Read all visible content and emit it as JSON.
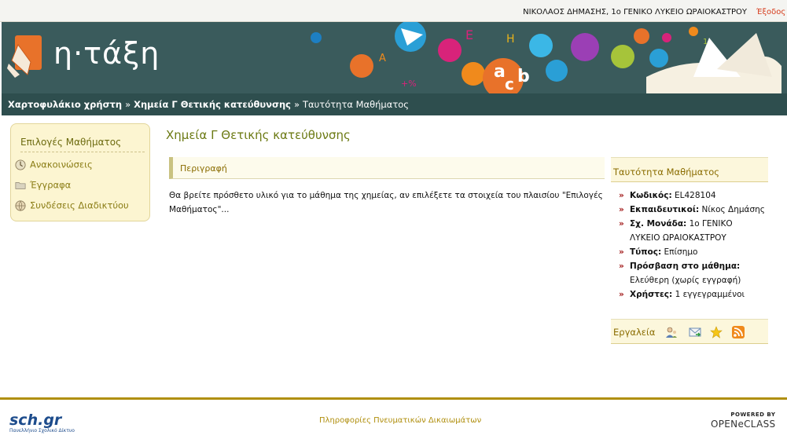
{
  "user_bar": {
    "user": "ΝΙΚΟΛΑΟΣ ΔΗΜΑΣΗΣ, 1ο ΓΕΝΙΚΟ ΛΥΚΕΙΟ ΩΡΑΙΟΚΑΣΤΡΟΥ",
    "logout": "Έξοδος"
  },
  "logo": {
    "text": "η·τάξη"
  },
  "breadcrumb": {
    "items": [
      "Χαρτοφυλάκιο χρήστη",
      "Χημεία Γ Θετικής κατεύθυνσης",
      "Ταυτότητα Μαθήματος"
    ],
    "separator": "»"
  },
  "sidebar": {
    "title": "Επιλογές Μαθήματος",
    "items": [
      {
        "label": "Ανακοινώσεις",
        "icon": "clock-icon"
      },
      {
        "label": "Έγγραφα",
        "icon": "folder-icon"
      },
      {
        "label": "Συνδέσεις Διαδικτύου",
        "icon": "globe-icon"
      }
    ]
  },
  "main": {
    "course_title": "Χημεία Γ Θετικής κατεύθυνσης",
    "section_label": "Περιγραφή",
    "description_line1": "Θα βρείτε πρόσθετο υλικό για το μάθημα της χημείας, αν επιλέξετε τα στοιχεία του πλαισίου \"Επιλογές",
    "description_line2": "Μαθήματος\"..."
  },
  "course_info": {
    "title": "Ταυτότητα Μαθήματος",
    "rows": [
      {
        "label": "Κωδικός:",
        "value": "EL428104"
      },
      {
        "label": "Εκπαιδευτικοί:",
        "value": "Νίκος Δημάσης"
      },
      {
        "label": "Σχ. Μονάδα:",
        "value": "1ο ΓΕΝΙΚΟ",
        "value2": "ΛΥΚΕΙΟ ΩΡΑΙΟΚΑΣΤΡΟΥ"
      },
      {
        "label": "Τύπος:",
        "value": "Επίσημο"
      },
      {
        "label": "Πρόσβαση στο μάθημα:",
        "value2": "Ελεύθερη (χωρίς εγγραφή)"
      },
      {
        "label": "Χρήστες:",
        "value": "1 εγγεγραμμένοι"
      }
    ]
  },
  "tools": {
    "label": "Εργαλεία",
    "icons": [
      "users-icon",
      "mail-icon",
      "star-icon",
      "rss-icon"
    ]
  },
  "footer": {
    "sch_logo": "sch.gr",
    "sch_sub": "Πανελλήνιο Σχολικό Δίκτυο",
    "rights": "Πληροφορίες Πνευματικών Δικαιωμάτων",
    "powered_by": "POWERED BY",
    "openeclass": "OPENeCLASS"
  },
  "colors": {
    "banner": "#3a5b5c",
    "breadcrumb": "#2e4e4e",
    "accent_olive": "#6c7a14",
    "accent_gold": "#b08f0e",
    "arrow_red": "#a21b1b",
    "logout_red": "#d63a1a"
  }
}
